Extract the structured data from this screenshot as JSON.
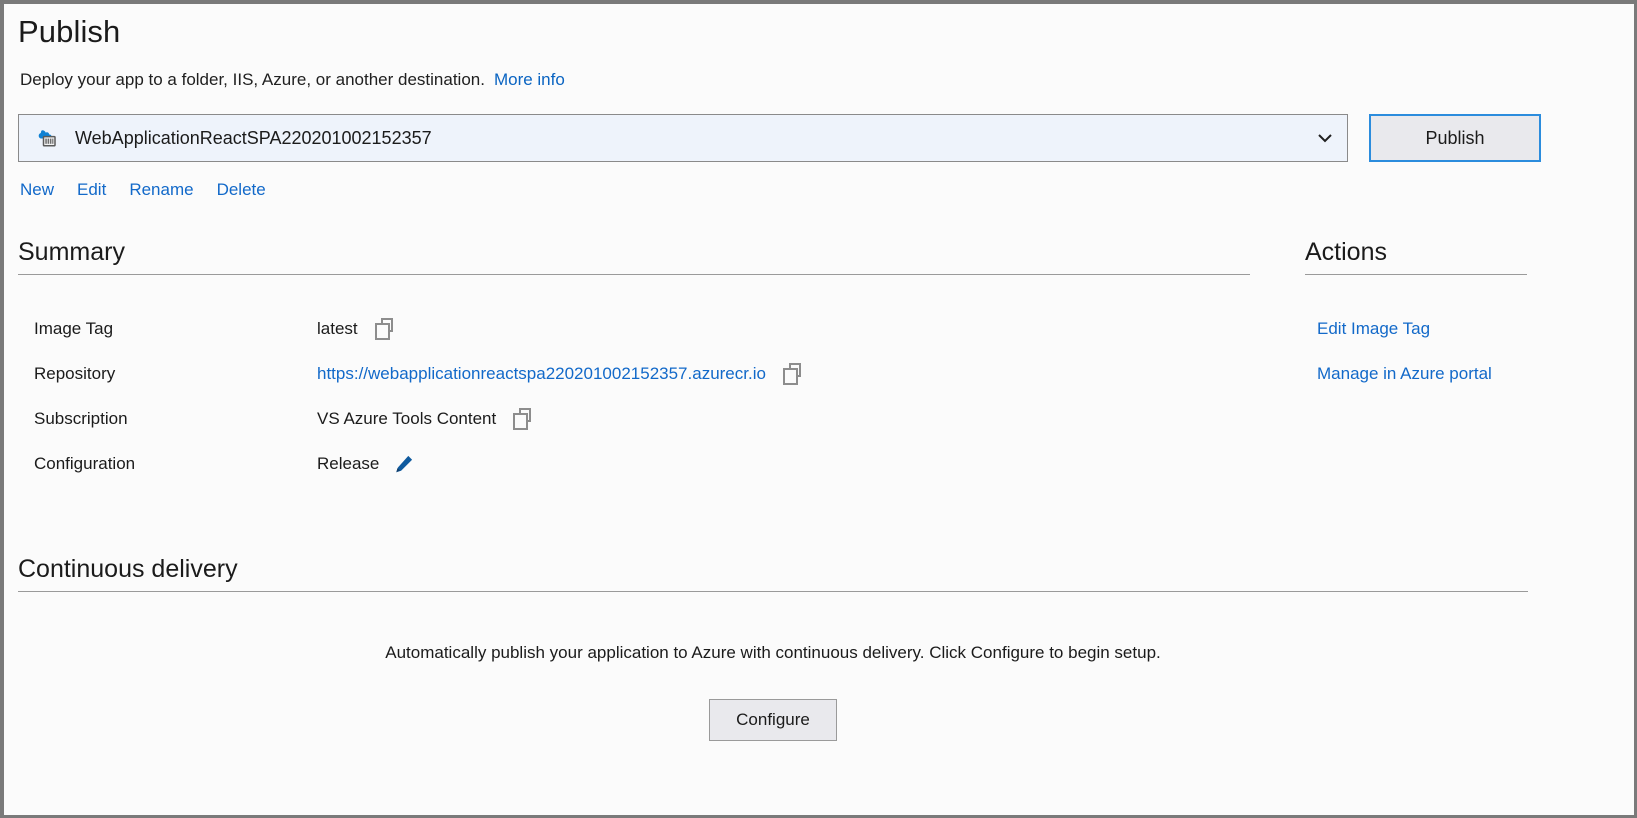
{
  "window": {
    "title": "Publish",
    "subtitle": "Deploy your app to a folder, IIS, Azure, or another destination.",
    "more_info_label": "More info"
  },
  "profile": {
    "icon": "azure-container-registry-icon",
    "selected": "WebApplicationReactSPA220201002152357",
    "chevron_icon": "chevron-down-icon",
    "publish_button_label": "Publish",
    "links": [
      {
        "label": "New",
        "name": "new-profile-link"
      },
      {
        "label": "Edit",
        "name": "edit-profile-link"
      },
      {
        "label": "Rename",
        "name": "rename-profile-link"
      },
      {
        "label": "Delete",
        "name": "delete-profile-link"
      }
    ]
  },
  "summary": {
    "heading": "Summary",
    "rows": [
      {
        "label": "Image Tag",
        "value": "latest",
        "type": "text",
        "trailing_icon": "copy-icon"
      },
      {
        "label": "Repository",
        "value": "https://webapplicationreactspa220201002152357.azurecr.io",
        "type": "link",
        "trailing_icon": "copy-icon"
      },
      {
        "label": "Subscription",
        "value": "VS Azure Tools Content",
        "type": "text",
        "trailing_icon": "copy-icon"
      },
      {
        "label": "Configuration",
        "value": "Release",
        "type": "text",
        "trailing_icon": "pencil-icon"
      }
    ]
  },
  "actions": {
    "heading": "Actions",
    "items": [
      {
        "label": "Edit Image Tag",
        "name": "edit-image-tag-action"
      },
      {
        "label": "Manage in Azure portal",
        "name": "manage-in-azure-portal-action"
      }
    ]
  },
  "continuous_delivery": {
    "heading": "Continuous delivery",
    "description": "Automatically publish your application to Azure with continuous delivery. Click Configure to begin setup.",
    "configure_button_label": "Configure"
  },
  "colors": {
    "link": "#1269c9",
    "accent": "#2b8cdd",
    "azure_cloud": "#0078d4",
    "pencil": "#0f5a9e",
    "background": "#fbfbfb",
    "combo_background": "#eef3fb",
    "button_face": "#e9e9ed",
    "rule": "#9a9a9a",
    "text": "#1b1b1b"
  }
}
